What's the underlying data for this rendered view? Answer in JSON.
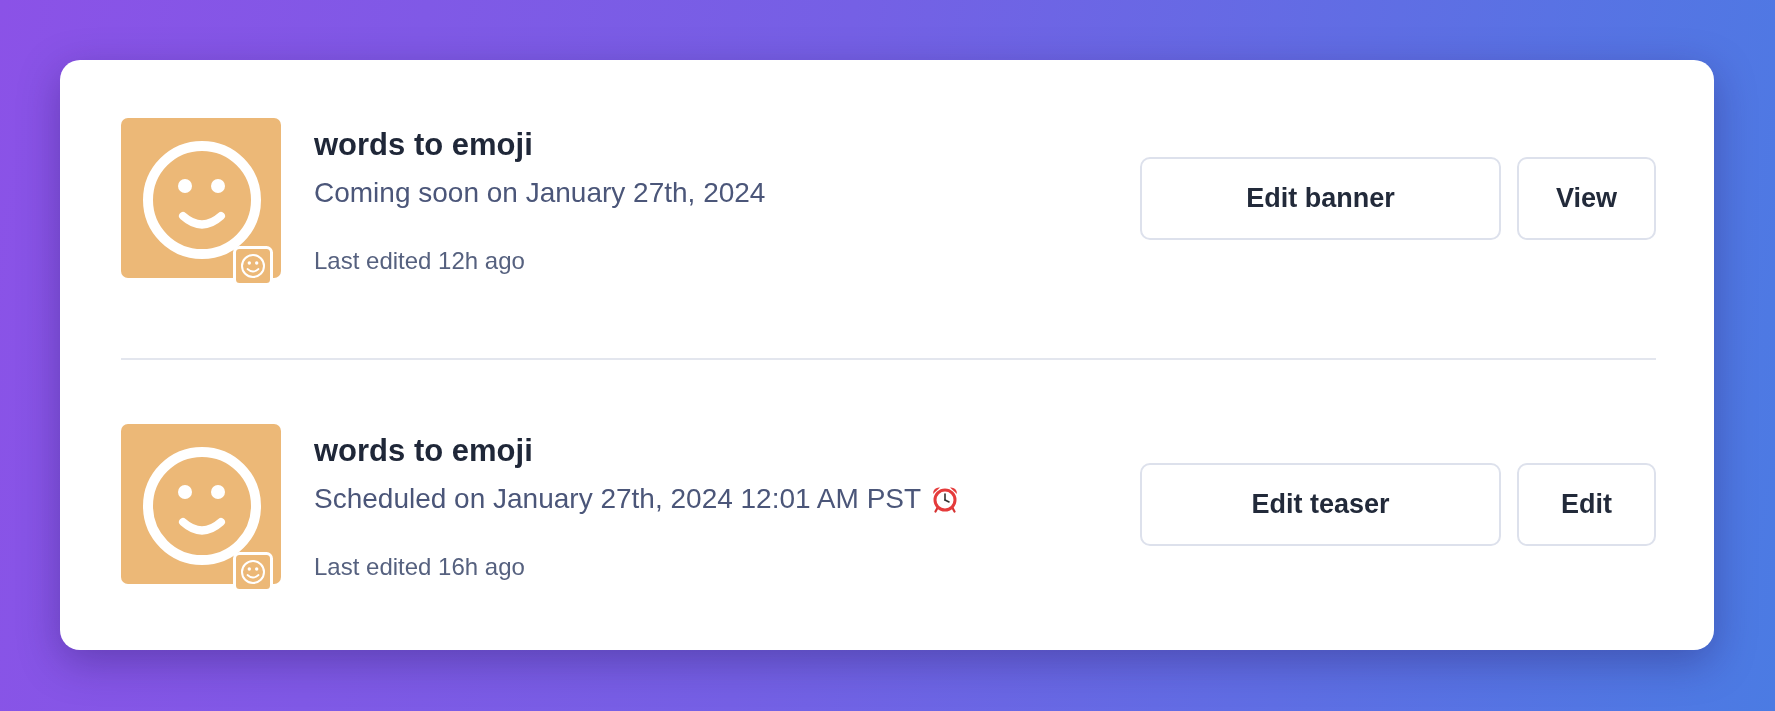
{
  "items": [
    {
      "kind": "coming_soon",
      "title": "words to emoji",
      "subtitle": "Coming soon on January 27th, 2024",
      "edited": "Last edited 12h ago",
      "buttons": [
        "Edit banner",
        "View"
      ]
    },
    {
      "kind": "scheduled",
      "title": "words to emoji",
      "subtitle": "Scheduled on January 27th, 2024 12:01 AM PST",
      "edited": "Last edited 16h ago",
      "buttons": [
        "Edit teaser",
        "Edit"
      ]
    }
  ]
}
